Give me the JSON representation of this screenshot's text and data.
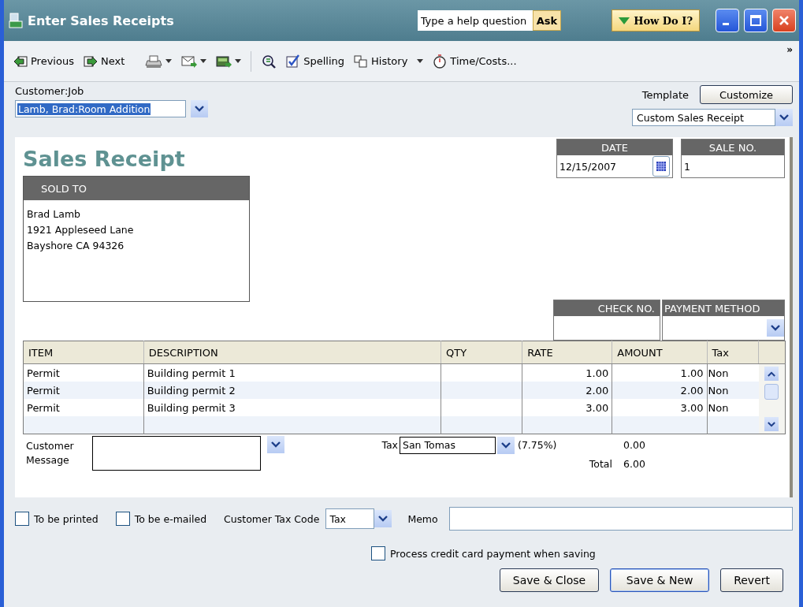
{
  "window": {
    "title": "Enter Sales Receipts"
  },
  "help": {
    "placeholder": "Type a help question",
    "ask": "Ask",
    "how_do_i": "How Do I?"
  },
  "toolbar": [
    {
      "kind": "prev",
      "label": "Previous"
    },
    {
      "kind": "next",
      "label": "Next"
    },
    {
      "kind": "print"
    },
    {
      "kind": "email"
    },
    {
      "kind": "ship"
    },
    {
      "kind": "find"
    },
    {
      "kind": "spelling",
      "label": "Spelling"
    },
    {
      "kind": "history",
      "label": "History"
    },
    {
      "kind": "time",
      "label": "Time/Costs..."
    },
    {
      "kind": "more",
      "label": "»"
    }
  ],
  "customer_job": {
    "label": "Customer:Job",
    "value": "Lamb, Brad:Room Addition"
  },
  "template": {
    "label": "Template",
    "customize": "Customize",
    "value": "Custom Sales Receipt"
  },
  "form": {
    "title": "Sales Receipt",
    "sold_to": {
      "label": "SOLD TO",
      "lines": [
        "Brad Lamb",
        "1921 Appleseed Lane",
        "Bayshore CA 94326"
      ]
    },
    "date": {
      "label": "DATE",
      "value": "12/15/2007"
    },
    "sale_no": {
      "label": "SALE NO.",
      "value": "1"
    },
    "check_no": {
      "label": "CHECK NO."
    },
    "payment_method": {
      "label": "PAYMENT METHOD"
    }
  },
  "table": {
    "columns": [
      "ITEM",
      "DESCRIPTION",
      "QTY",
      "RATE",
      "AMOUNT",
      "Tax"
    ],
    "rows": [
      [
        "Permit",
        "Building permit 1",
        "",
        "1.00",
        "1.00",
        "Non"
      ],
      [
        "Permit",
        "Building permit 2",
        "",
        "2.00",
        "2.00",
        "Non"
      ],
      [
        "Permit",
        "Building permit 3",
        "",
        "3.00",
        "3.00",
        "Non"
      ]
    ]
  },
  "totals": {
    "message_label": [
      "Customer",
      "Message"
    ],
    "tax_label": "Tax",
    "tax_value": "San Tomas",
    "tax_rate": "(7.75%)",
    "tax_amount": "0.00",
    "total_label": "Total",
    "total": "6.00"
  },
  "options": [
    {
      "label": "To be printed",
      "checked": false
    },
    {
      "label": "To be e-mailed",
      "checked": false
    }
  ],
  "tax_code": {
    "label": "Customer Tax Code",
    "value": "Tax"
  },
  "memo": {
    "label": "Memo"
  },
  "process_card": {
    "label": "Process credit card payment when saving",
    "checked": false
  },
  "buttons": [
    "Save & Close",
    "Save & New",
    "Revert"
  ]
}
